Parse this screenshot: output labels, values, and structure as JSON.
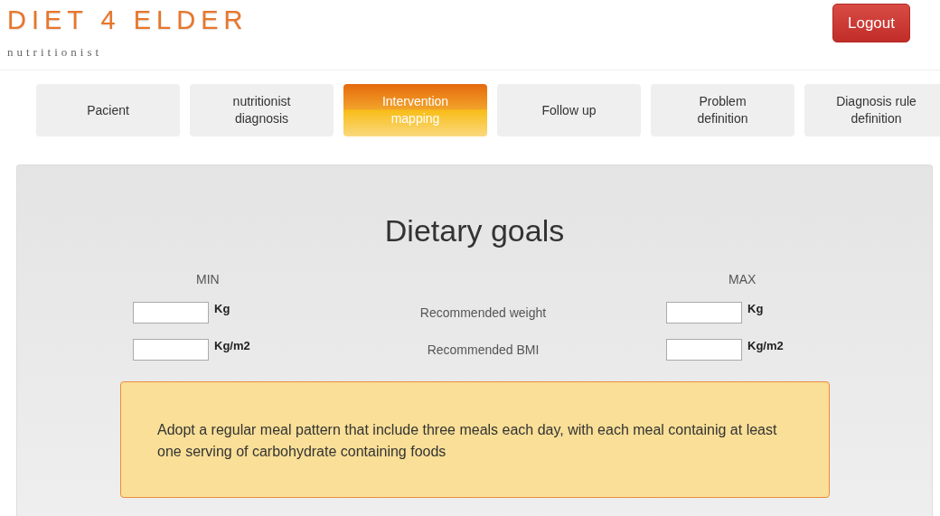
{
  "header": {
    "logo": "DIET 4 ELDER",
    "subtitle": "nutritionist",
    "logout": "Logout"
  },
  "tabs": [
    {
      "label": "Pacient",
      "selected": false
    },
    {
      "label": "nutritionist diagnosis",
      "selected": false
    },
    {
      "label": "Intervention mapping",
      "selected": true
    },
    {
      "label": "Follow up",
      "selected": false
    },
    {
      "label": "Problem definition",
      "selected": false
    },
    {
      "label": "Diagnosis rule definition",
      "selected": false
    }
  ],
  "panel": {
    "title": "Dietary goals",
    "min_header": "MIN",
    "max_header": "MAX",
    "rows": [
      {
        "label": "Recommended weight",
        "min_unit": "Kg",
        "max_unit": "Kg"
      },
      {
        "label": "Recommended BMI",
        "min_unit": "Kg/m2",
        "max_unit": "Kg/m2"
      }
    ],
    "note": "Adopt a regular meal pattern that include three meals each day, with each meal containig at least one serving of carbohydrate containing foods"
  }
}
